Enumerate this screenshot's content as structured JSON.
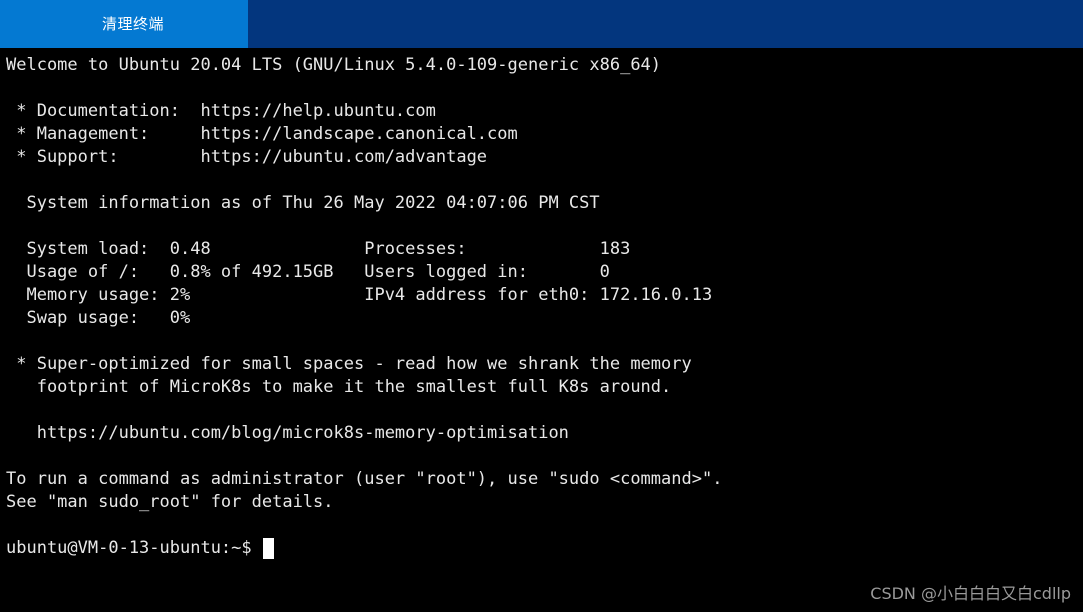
{
  "titlebar": {
    "tab_label": "清理终端",
    "active_tab_color": "#0479d2",
    "bar_color": "#03367e"
  },
  "terminal": {
    "background_color": "#000000",
    "text_color": "#e8e8e8",
    "lines": [
      "Welcome to Ubuntu 20.04 LTS (GNU/Linux 5.4.0-109-generic x86_64)",
      "",
      " * Documentation:  https://help.ubuntu.com",
      " * Management:     https://landscape.canonical.com",
      " * Support:        https://ubuntu.com/advantage",
      "",
      "  System information as of Thu 26 May 2022 04:07:06 PM CST",
      "",
      "  System load:  0.48               Processes:             183",
      "  Usage of /:   0.8% of 492.15GB   Users logged in:       0",
      "  Memory usage: 2%                 IPv4 address for eth0: 172.16.0.13",
      "  Swap usage:   0%",
      "",
      " * Super-optimized for small spaces - read how we shrank the memory",
      "   footprint of MicroK8s to make it the smallest full K8s around.",
      "",
      "   https://ubuntu.com/blog/microk8s-memory-optimisation",
      "",
      "To run a command as administrator (user \"root\"), use \"sudo <command>\".",
      "See \"man sudo_root\" for details.",
      ""
    ],
    "prompt": "ubuntu@VM-0-13-ubuntu:~$",
    "input_value": "",
    "cursor": "block"
  },
  "watermark": {
    "text": "CSDN @小白白白又白cdllp",
    "color": "#9a9a9a"
  }
}
